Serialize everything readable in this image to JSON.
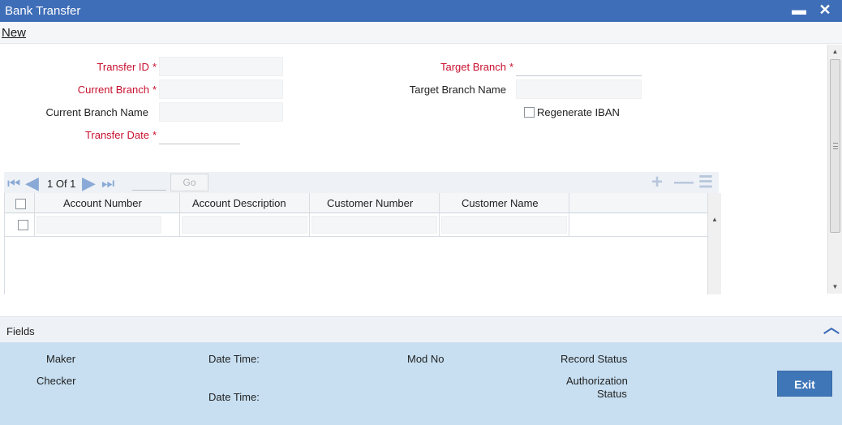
{
  "window": {
    "title": "Bank Transfer",
    "minimize_glyph": "▬",
    "close_glyph": "✕"
  },
  "menu": {
    "new_label": "New"
  },
  "form": {
    "transfer_id_label": "Transfer ID",
    "current_branch_label": "Current Branch",
    "current_branch_name_label": "Current Branch Name",
    "transfer_date_label": "Transfer Date",
    "target_branch_label": "Target Branch",
    "target_branch_name_label": "Target Branch Name",
    "regenerate_iban_label": "Regenerate IBAN",
    "required_marker": "*"
  },
  "pager": {
    "page_text": "1 Of 1",
    "go_label": "Go"
  },
  "grid": {
    "columns": [
      "Account Number",
      "Account Description",
      "Customer Number",
      "Customer Name"
    ]
  },
  "fields_bar": {
    "label": "Fields"
  },
  "audit": {
    "maker_label": "Maker",
    "checker_label": "Checker",
    "date_time_label_1": "Date Time:",
    "date_time_label_2": "Date Time:",
    "mod_no_label": "Mod No",
    "record_status_label": "Record Status",
    "authorization_label_1": "Authorization",
    "authorization_label_2": "Status",
    "exit_label": "Exit"
  },
  "colors": {
    "title_bar": "#3f6eb8",
    "required_text": "#c8102e",
    "audit_panel": "#c7dff1",
    "exit_button": "#3f76b8"
  }
}
